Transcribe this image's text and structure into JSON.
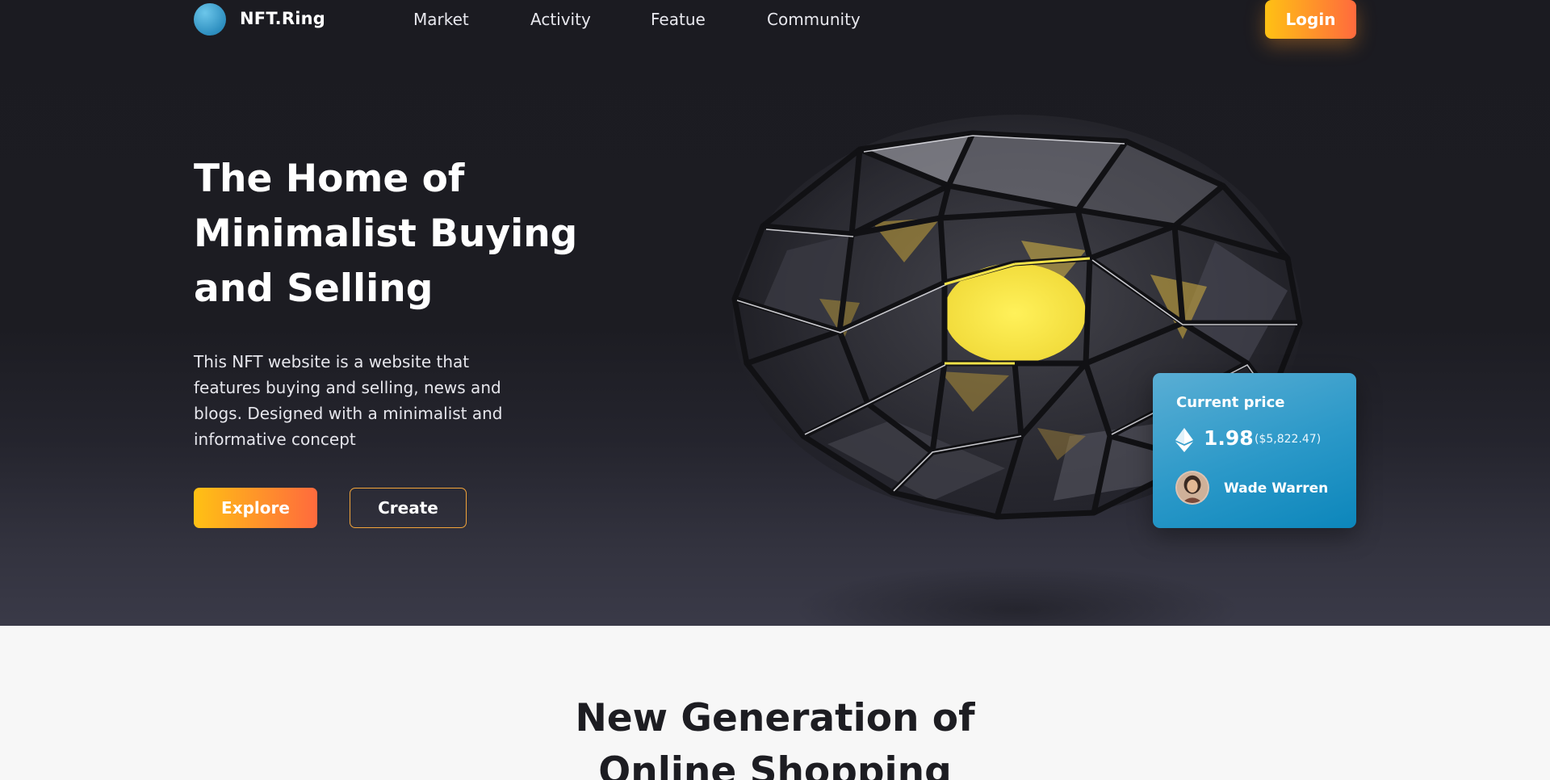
{
  "brand": {
    "name": "NFT.Ring"
  },
  "nav": {
    "items": [
      "Market",
      "Activity",
      "Featue",
      "Community"
    ],
    "login_label": "Login"
  },
  "hero": {
    "title_lines": [
      "The Home of",
      "Minimalist Buying",
      "and Selling"
    ],
    "description": "This NFT website is a website that features buying and selling, news and blogs. Designed with a minimalist and informative concept",
    "explore_label": "Explore",
    "create_label": "Create",
    "art_icon": "geodesic-sphere-artwork"
  },
  "price_card": {
    "label": "Current price",
    "currency_icon": "ethereum-icon",
    "value": "1.98",
    "usd": "($5,822.47)",
    "owner": "Wade Warren"
  },
  "section2": {
    "title_lines": [
      "New Generation of",
      "Online Shopping"
    ]
  },
  "colors": {
    "accent_start": "#ffc114",
    "accent_end": "#ff6a3d",
    "card_blue": "#2a98c8",
    "hero_bg": "#1b1b21",
    "section_bg": "#f7f7f7"
  }
}
